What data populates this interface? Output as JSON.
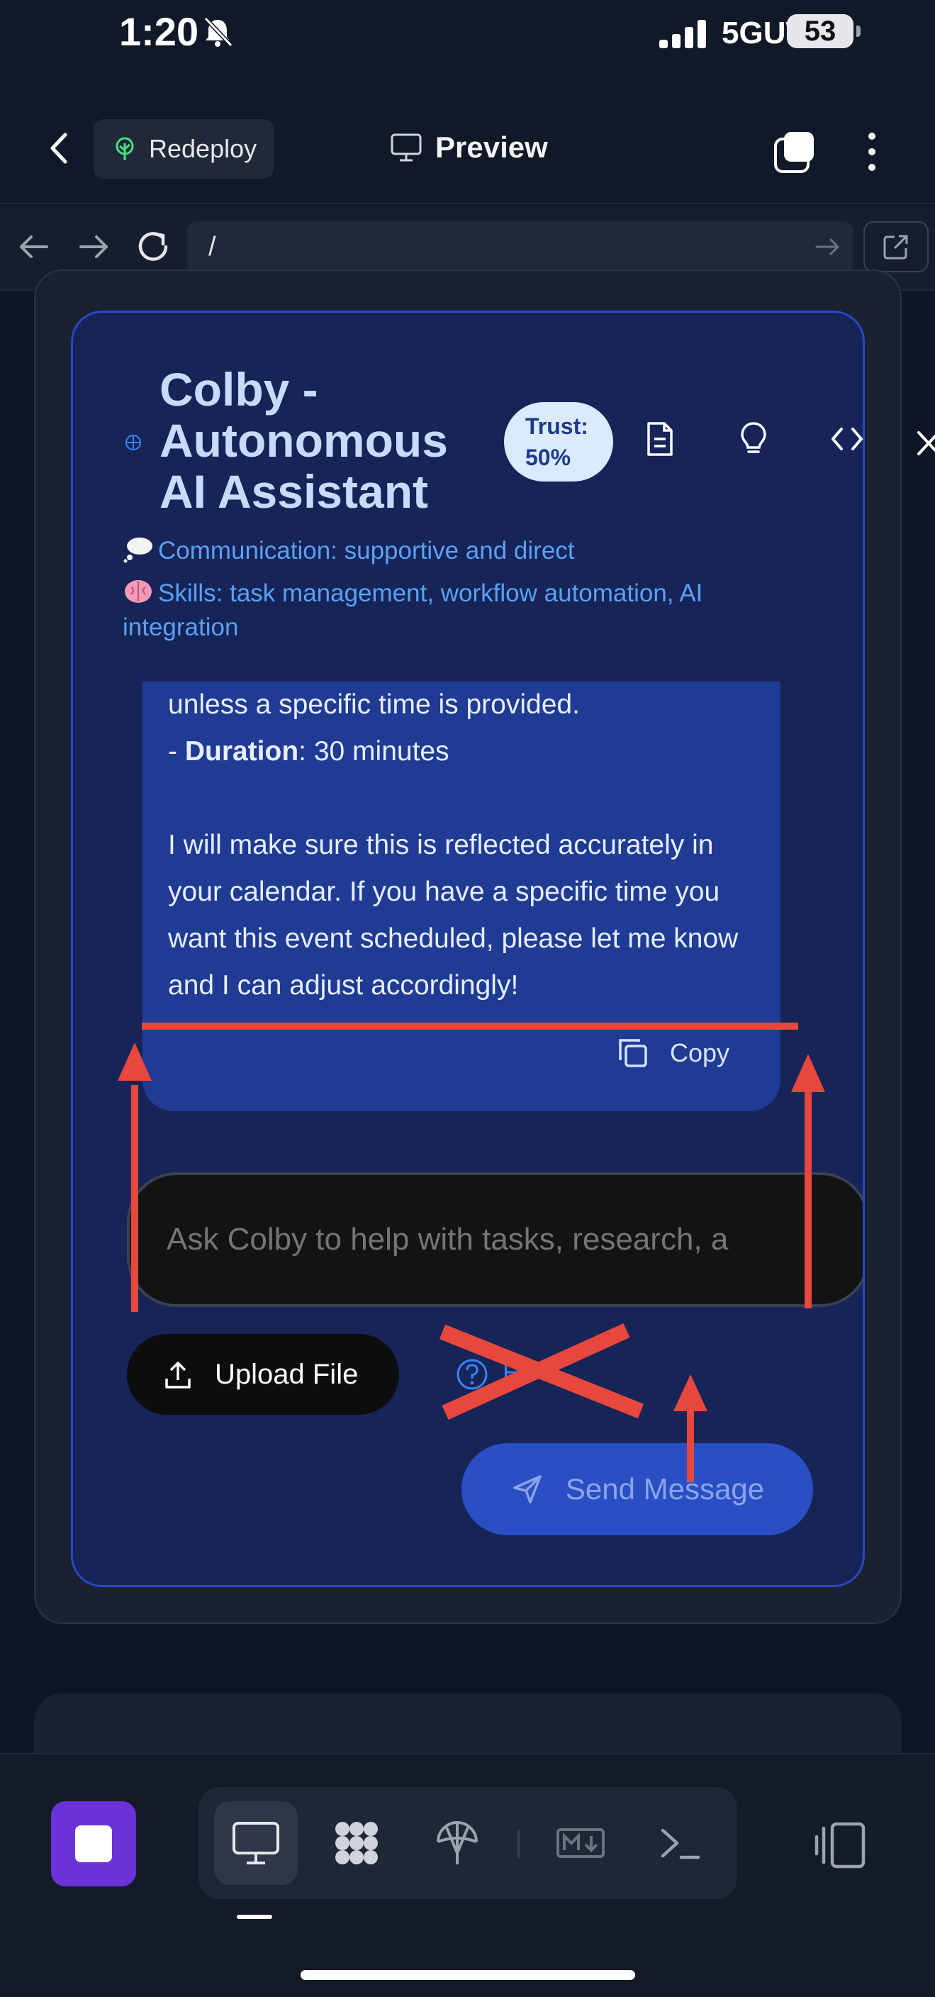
{
  "status": {
    "time": "1:20",
    "network": "5GUW",
    "battery": "53"
  },
  "header": {
    "redeploy_label": "Redeploy",
    "title": "Preview"
  },
  "browser": {
    "url": "/"
  },
  "agent": {
    "title": "Colby - Autonomous AI Assistant",
    "trust_label": "Trust:",
    "trust_value": "50%",
    "communication": "Communication: supportive and direct",
    "skills": "Skills: task management, workflow automation, AI integration"
  },
  "message": {
    "line1": "unless a specific time is provided.",
    "duration_prefix": "- ",
    "duration_label": "Duration",
    "duration_value": ": 30 minutes",
    "body": "I will make sure this is reflected accurately in your calendar. If you have a specific time you want this event scheduled, please let me know and I can adjust accordingly!",
    "copy_label": "Copy"
  },
  "composer": {
    "placeholder": "Ask Colby to help with tasks, research, a",
    "upload_label": "Upload File",
    "help_label": "H",
    "send_label": "Send Message"
  },
  "colors": {
    "accent": "#2947c4",
    "annotation": "#e8473d",
    "stop": "#6b32d8"
  },
  "icons": [
    "chevron-left-icon",
    "sprout-icon",
    "monitor-icon",
    "tabs-icon",
    "more-icon",
    "arrow-left-icon",
    "arrow-right-icon",
    "reload-icon",
    "external-link-icon",
    "globe-icon",
    "document-icon",
    "lightbulb-icon",
    "code-icon",
    "close-icon",
    "thought-bubble-icon",
    "brain-icon",
    "copy-icon",
    "upload-icon",
    "help-icon",
    "send-icon",
    "stop-icon",
    "monitor-icon",
    "apps-icon",
    "deploy-icon",
    "markdown-icon",
    "terminal-icon",
    "layout-toggle-icon"
  ]
}
